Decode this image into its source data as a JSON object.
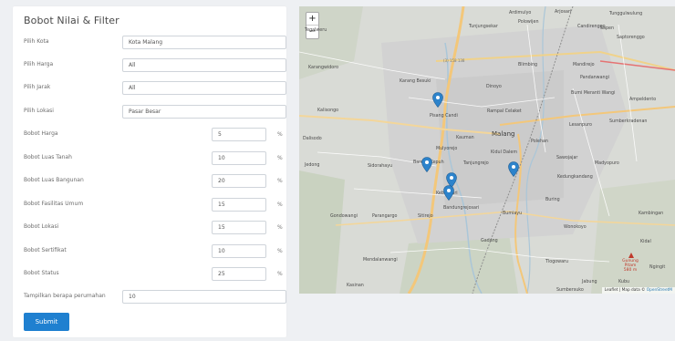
{
  "panel": {
    "title": "Bobot Nilai & Filter",
    "fields": [
      {
        "label": "Pilih Kota",
        "value": "Kota Malang",
        "kind": "wide"
      },
      {
        "label": "Pilih Harga",
        "value": "All",
        "kind": "wide"
      },
      {
        "label": "Pilih Jarak",
        "value": "All",
        "kind": "wide"
      },
      {
        "label": "Pilih Lokasi",
        "value": "Pasar Besar",
        "kind": "wide"
      },
      {
        "label": "Bobot Harga",
        "value": "5",
        "kind": "short",
        "unit": "%"
      },
      {
        "label": "Bobot Luas Tanah",
        "value": "10",
        "kind": "short",
        "unit": "%"
      },
      {
        "label": "Bobot Luas Bangunan",
        "value": "20",
        "kind": "short",
        "unit": "%"
      },
      {
        "label": "Bobot Fasilitas Umum",
        "value": "15",
        "kind": "short",
        "unit": "%"
      },
      {
        "label": "Bobot Lokasi",
        "value": "15",
        "kind": "short",
        "unit": "%"
      },
      {
        "label": "Bobot Sertifikat",
        "value": "10",
        "kind": "short",
        "unit": "%"
      },
      {
        "label": "Bobot Status",
        "value": "25",
        "kind": "short",
        "unit": "%"
      },
      {
        "label": "Tampilkan berapa perumahan",
        "value": "10",
        "kind": "wide"
      }
    ],
    "submit_label": "Submit"
  },
  "map": {
    "zoom_in": "+",
    "zoom_out": "−",
    "attribution_prefix": "Leaflet | Map data © ",
    "attribution_link": "OpenStreetM",
    "road_label": "(3) 158 138",
    "place_labels": [
      "Ardimulyo",
      "Arjosari",
      "Tunjungsekar",
      "Polowijen",
      "Tunggulwulung",
      "Candirenggo",
      "Sapen",
      "Saptorenggo",
      "Tegalweru",
      "Karangwidoro",
      "Karang Besuki",
      "Dinoyo",
      "Blimbing",
      "Mandirejo",
      "Pandanwangi",
      "Bumi Meranti Wangi",
      "Ampeldento",
      "Kalisongo",
      "Pisang Candi",
      "Rampal Celaket",
      "Lesanpuro",
      "Sumberkradenan",
      "Malang",
      "Dalisodo",
      "Mulyorejo",
      "Kauman",
      "Kidul Dalem",
      "Polehan",
      "Madyopuro",
      "Jedong",
      "Sidorahayu",
      "Bareng Kepuh",
      "Tanjungrejo",
      "Sawojajar",
      "Kedungkandang",
      "Gondowangi",
      "Parangargo",
      "Sitirejo",
      "Bandungrejosari",
      "Bumiayu",
      "Buring",
      "Wonokoyo",
      "Kambingan",
      "Kebonsari",
      "Gadang",
      "Kidal",
      "Mendalanwangi",
      "Tlogowaru",
      "Kasinan",
      "Sumbersuko",
      "Kubu",
      "Ngingit",
      "Jabung"
    ],
    "peak_label": "Gunung Pitam 580 m"
  }
}
